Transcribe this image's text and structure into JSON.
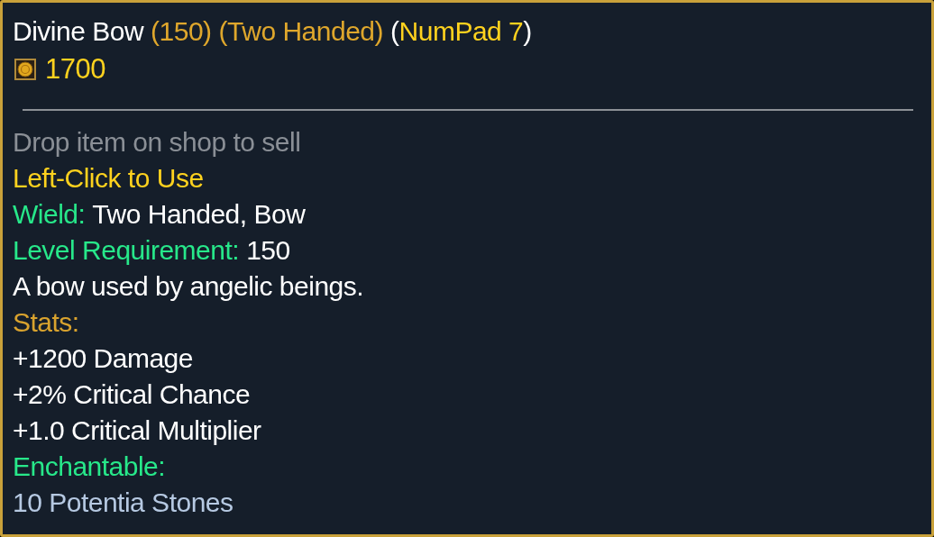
{
  "title": {
    "name": "Divine Bow",
    "tags": [
      "(150)",
      "(Two Handed)"
    ],
    "hotkey": {
      "open": "(",
      "key": "NumPad 7",
      "close": ")"
    }
  },
  "price": "1700",
  "lines": [
    {
      "kind": "hint",
      "text": "Drop item on shop to sell"
    },
    {
      "kind": "action",
      "text": "Left-Click to Use"
    },
    {
      "kind": "attribute",
      "label": "Wield:",
      "value": "Two Handed, Bow"
    },
    {
      "kind": "attribute",
      "label": "Level Requirement:",
      "value": "150"
    },
    {
      "kind": "description",
      "text": "A bow used by angelic beings."
    },
    {
      "kind": "section",
      "text": "Stats:"
    },
    {
      "kind": "stat",
      "text": "+1200 Damage"
    },
    {
      "kind": "stat",
      "text": "+2% Critical Chance"
    },
    {
      "kind": "stat",
      "text": "+1.0 Critical Multiplier"
    },
    {
      "kind": "enchant_section",
      "text": "Enchantable:"
    },
    {
      "kind": "enchant_value",
      "text": "10 Potentia Stones"
    }
  ]
}
